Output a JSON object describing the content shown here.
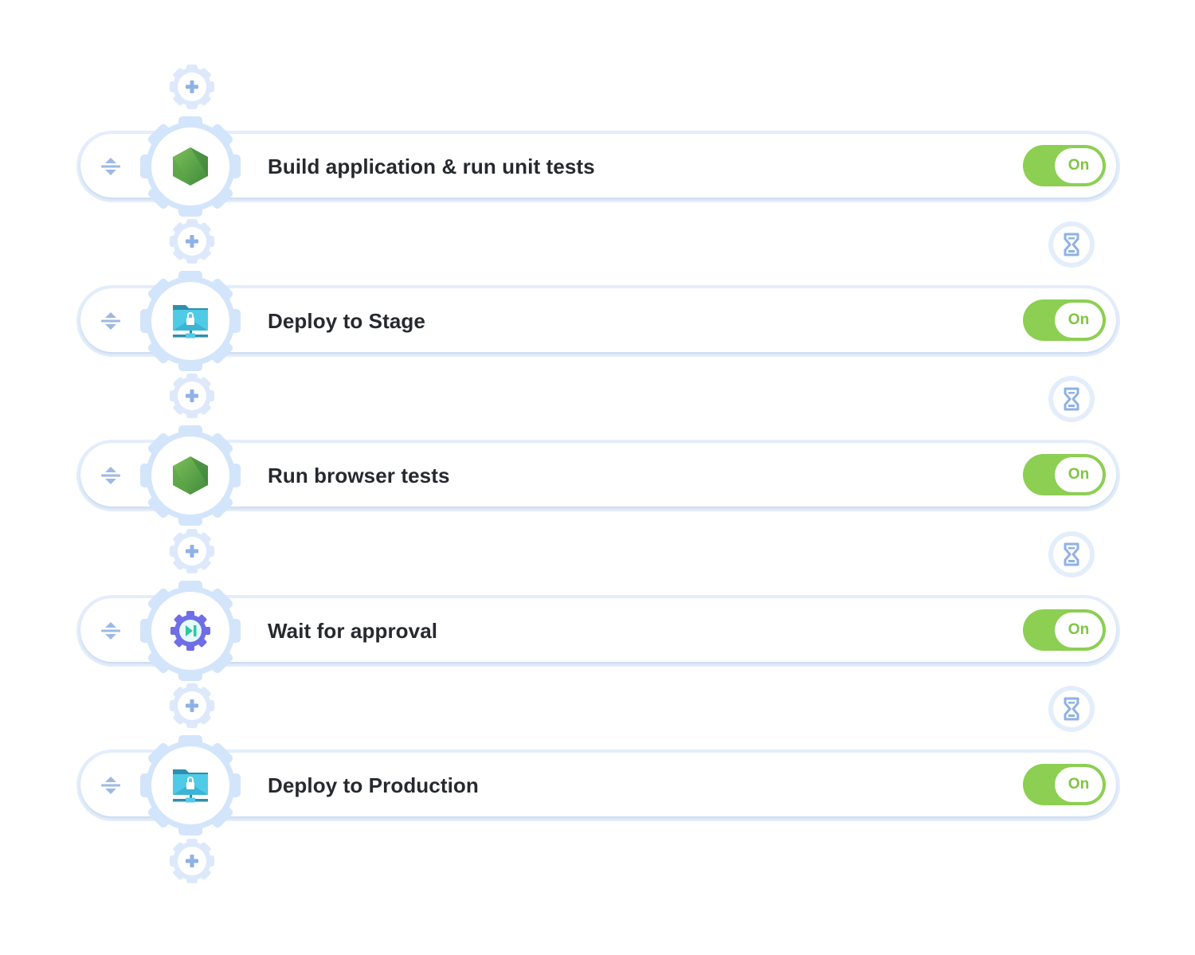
{
  "pipeline": {
    "steps": [
      {
        "label": "Build application & run unit tests",
        "icon": "nodejs-hexagon-icon",
        "toggle": {
          "state": "on",
          "label": "On"
        }
      },
      {
        "label": "Deploy to Stage",
        "icon": "network-folder-lock-icon",
        "toggle": {
          "state": "on",
          "label": "On"
        }
      },
      {
        "label": "Run browser tests",
        "icon": "nodejs-hexagon-icon",
        "toggle": {
          "state": "on",
          "label": "On"
        }
      },
      {
        "label": "Wait for approval",
        "icon": "approval-gear-icon",
        "toggle": {
          "state": "on",
          "label": "On"
        }
      },
      {
        "label": "Deploy to Production",
        "icon": "network-folder-lock-icon",
        "toggle": {
          "state": "on",
          "label": "On"
        }
      }
    ],
    "add_step_icon": "plus-gear-icon",
    "delay_icon": "hourglass-icon",
    "drag_icon": "sort-arrows-icon"
  },
  "colors": {
    "accent_light": "#d6e6fb",
    "icon_blue": "#8fb2e6",
    "toggle_green": "#8ccf52",
    "toggle_text": "#7dc63f",
    "label_text": "#26292e"
  }
}
